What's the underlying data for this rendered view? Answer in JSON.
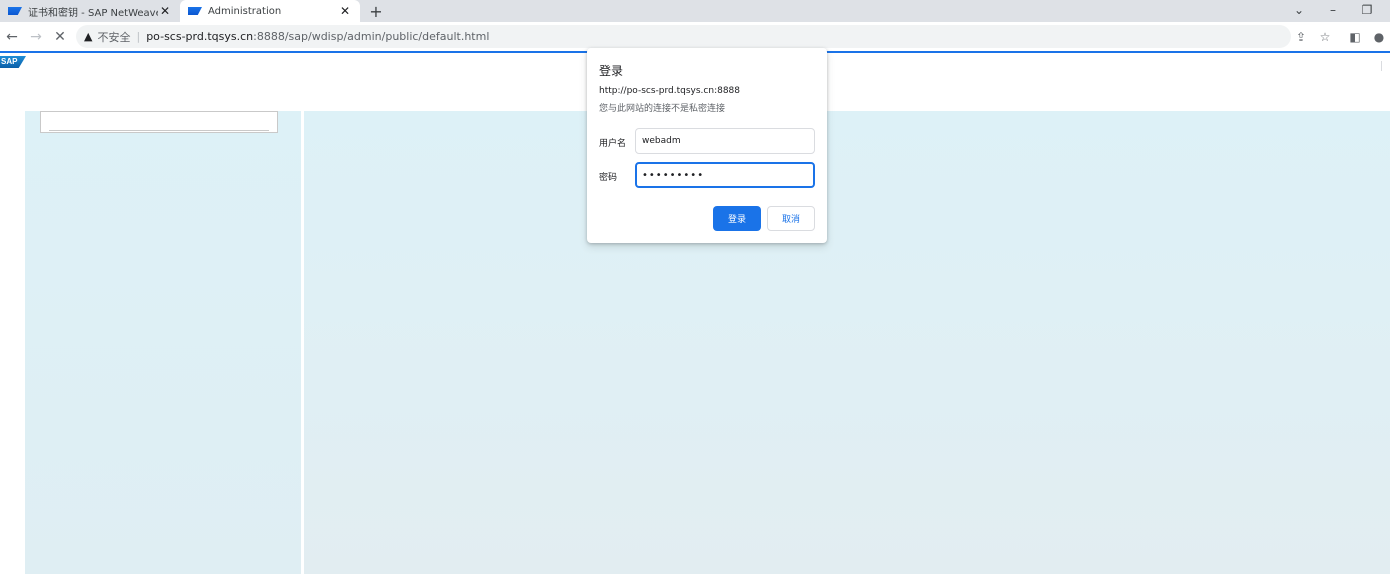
{
  "browser": {
    "tabs": [
      {
        "title": "证书和密钥 - SAP NetWeaver A",
        "active": false
      },
      {
        "title": "Administration",
        "active": true
      }
    ],
    "new_tab_glyph": "+",
    "window_controls": [
      "⌄",
      "–",
      "❐"
    ],
    "omnibox": {
      "security_label": "不安全",
      "host": "po-scs-prd.tqsys.cn",
      "path": ":8888/sap/wdisp/admin/public/default.html"
    }
  },
  "page": {
    "logo_text": "SAP"
  },
  "login_dialog": {
    "title": "登录",
    "url": "http://po-scs-prd.tqsys.cn:8888",
    "note": "您与此网站的连接不是私密连接",
    "username_label": "用户名",
    "username_value": "webadm",
    "password_label": "密码",
    "password_value": "•••••••••",
    "login_button": "登录",
    "cancel_button": "取消"
  },
  "colors": {
    "accent": "#1a73e8",
    "content_bg": "#ddf1f7"
  }
}
